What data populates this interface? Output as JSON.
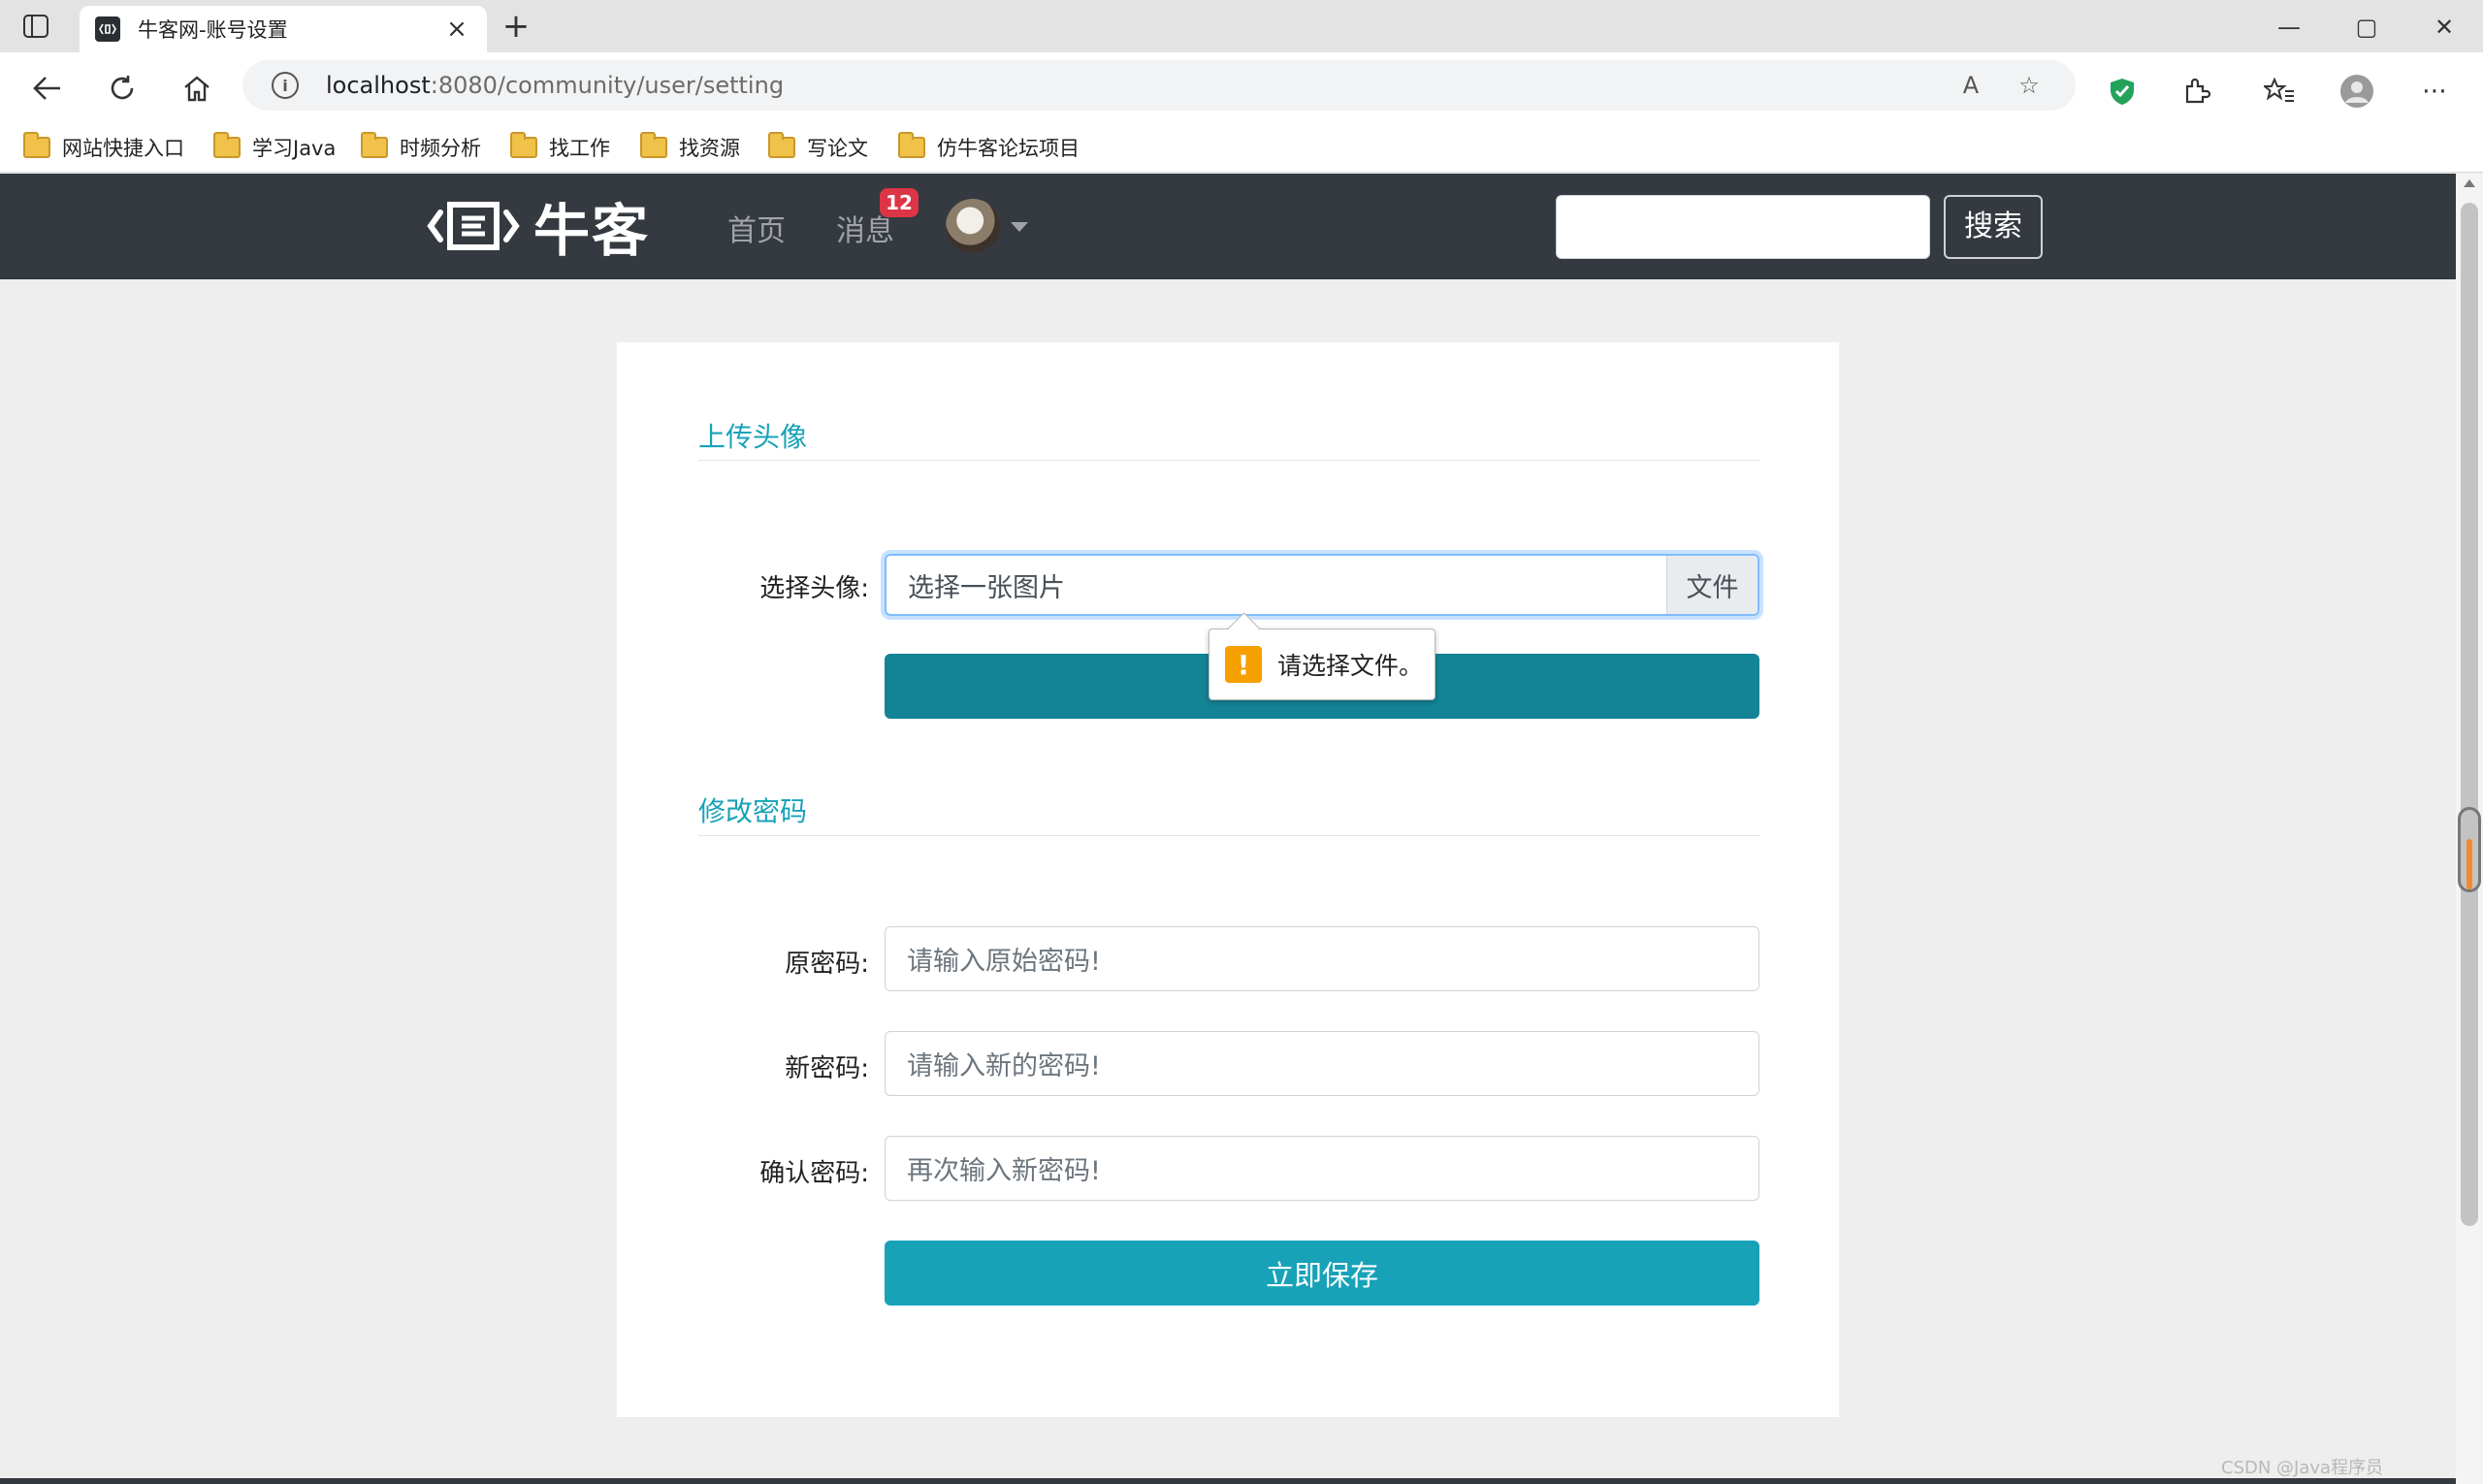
{
  "browser": {
    "tab_title": "牛客网-账号设置",
    "new_tab_symbol": "+",
    "close_tab_symbol": "×",
    "url_host": "localhost",
    "url_path": ":8080/community/user/setting",
    "window_controls": {
      "minimize": "—",
      "maximize": "▢",
      "close": "✕"
    }
  },
  "bookmarks": [
    {
      "label": "网站快捷入口"
    },
    {
      "label": "学习Java"
    },
    {
      "label": "时频分析"
    },
    {
      "label": "找工作"
    },
    {
      "label": "找资源"
    },
    {
      "label": "写论文"
    },
    {
      "label": "仿牛客论坛项目"
    }
  ],
  "site_nav": {
    "brand": "牛客",
    "home": "首页",
    "messages": "消息",
    "messages_badge": "12",
    "search_placeholder": "",
    "search_button": "搜索"
  },
  "upload_section": {
    "title": "上传头像",
    "choose_label": "选择头像:",
    "file_placeholder": "选择一张图片",
    "browse_label": "文件",
    "validation_tooltip": "请选择文件。",
    "warning_symbol": "!"
  },
  "password_section": {
    "title": "修改密码",
    "old_label": "原密码:",
    "old_placeholder": "请输入原始密码!",
    "new_label": "新密码:",
    "new_placeholder": "请输入新的密码!",
    "confirm_label": "确认密码:",
    "confirm_placeholder": "再次输入新密码!",
    "save_button": "立即保存"
  },
  "watermark": "CSDN @Java程序员",
  "colors": {
    "accent": "#17a2b8",
    "upload_button": "#138496",
    "navbar": "#343a40",
    "badge": "#dc3545",
    "warning": "#f59f00"
  }
}
